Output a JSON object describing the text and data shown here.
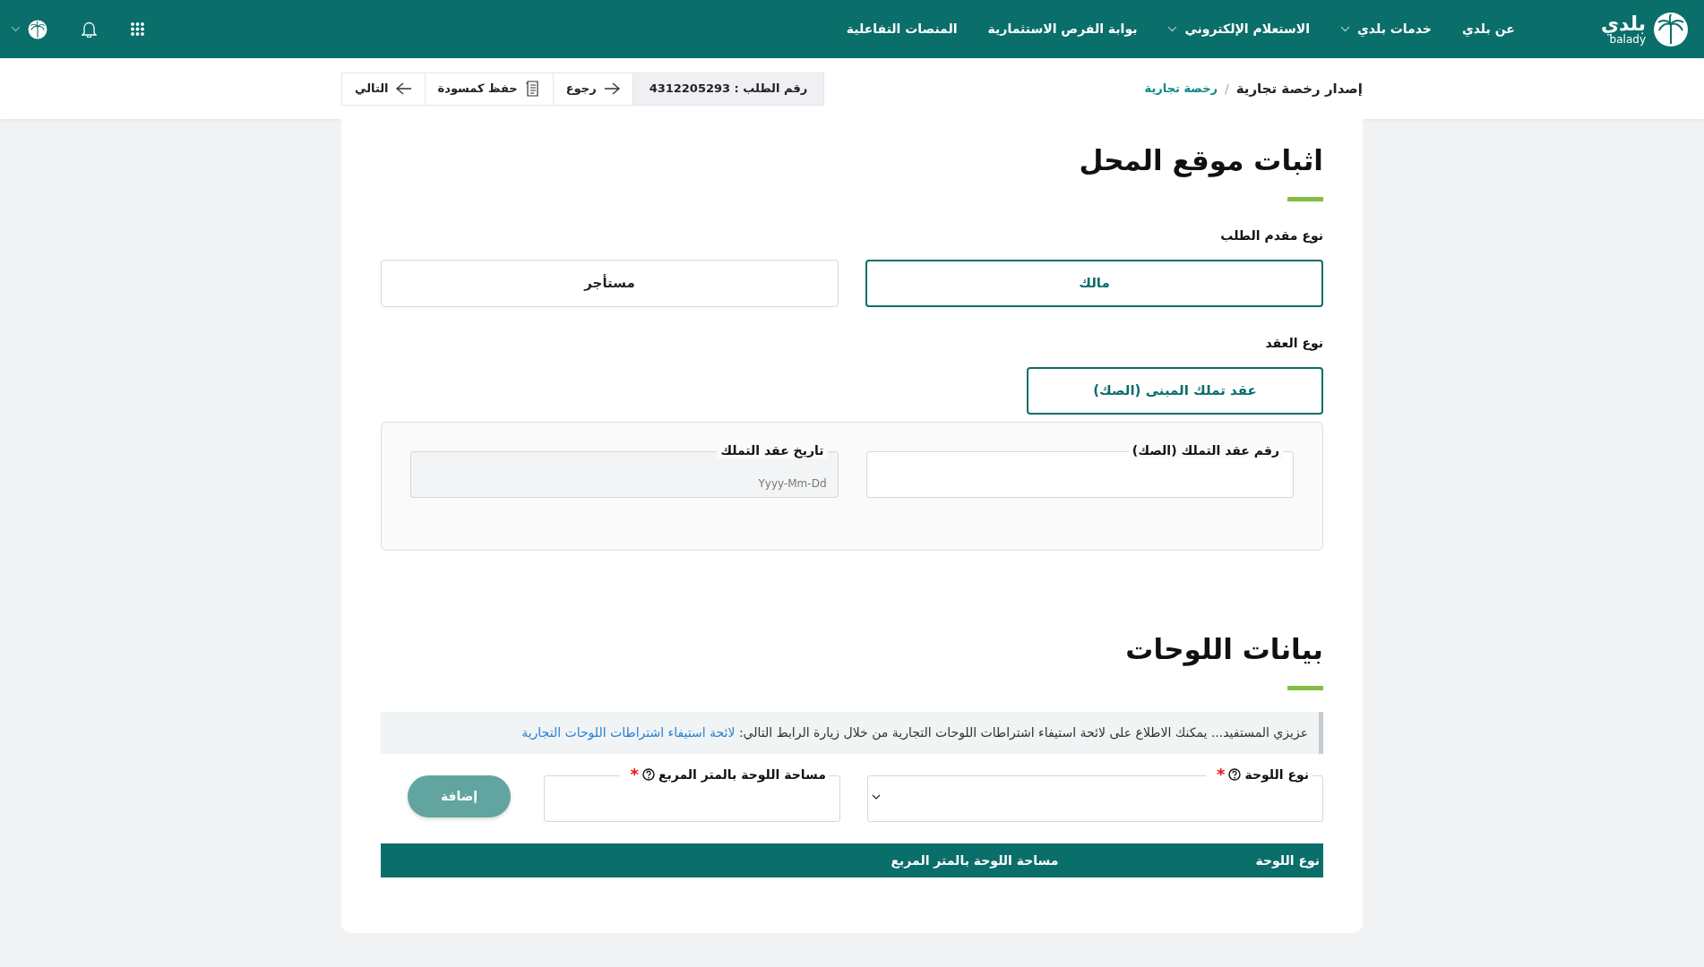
{
  "header": {
    "logo_text": "بلدي",
    "logo_subtext": "balady",
    "nav": [
      {
        "label": "عن بلدي",
        "dropdown": false
      },
      {
        "label": "خدمات بلدي",
        "dropdown": true
      },
      {
        "label": "الاستعلام الإلكتروني",
        "dropdown": true
      },
      {
        "label": "بوابة الفرص الاستثمارية",
        "dropdown": false
      },
      {
        "label": "المنصات التفاعلية",
        "dropdown": false
      }
    ]
  },
  "breadcrumb": {
    "separator": "/",
    "items": [
      {
        "label": "إصدار رخصة تجارية",
        "link": false
      },
      {
        "label": "رخصة تجارية",
        "link": true
      }
    ]
  },
  "toolbar": {
    "request_number": "رقم الطلب : 4312205293",
    "actions": [
      {
        "kind": "back",
        "label": "رجوع"
      },
      {
        "kind": "draft",
        "label": "حفظ كمسودة"
      },
      {
        "kind": "next",
        "label": "التالي"
      }
    ]
  },
  "location": {
    "title": "اثبات موقع المحل",
    "applicant_type": {
      "label": "نوع مقدم الطلب",
      "options": [
        {
          "label": "مالك",
          "selected": true
        },
        {
          "label": "مستأجر",
          "selected": false
        }
      ]
    },
    "contract_type": {
      "label": "نوع العقد",
      "options": [
        {
          "label": "عقد تملك المبنى (الصك)",
          "selected": true
        }
      ]
    },
    "fields": [
      {
        "label": "رقم عقد التملك (الصك)",
        "disabled": false
      },
      {
        "label": "تاريخ عقد التملك",
        "placeholder": "Yyyy-Mm-Dd",
        "disabled": true
      }
    ]
  },
  "signs": {
    "title": "بيانات اللوحات",
    "notice": {
      "text": "عزيزي المستفيد... يمكنك الاطلاع على لائحة استيفاء اشتراطات اللوحات التجارية من خلال زيارة الرابط التالي:",
      "link": "لائحة استيفاء اشتراطات اللوحات التجارية"
    },
    "fields": [
      {
        "kind": "select",
        "label": "نوع اللوحة",
        "marker": "*"
      },
      {
        "kind": "text",
        "label": "مساحة اللوحة بالمتر المربع",
        "marker": "*"
      }
    ],
    "add_button": {
      "label": "إضافة",
      "disabled": true
    },
    "table": {
      "columns": [
        "نوع اللوحة",
        "مساحة اللوحة بالمتر المربع"
      ]
    }
  }
}
